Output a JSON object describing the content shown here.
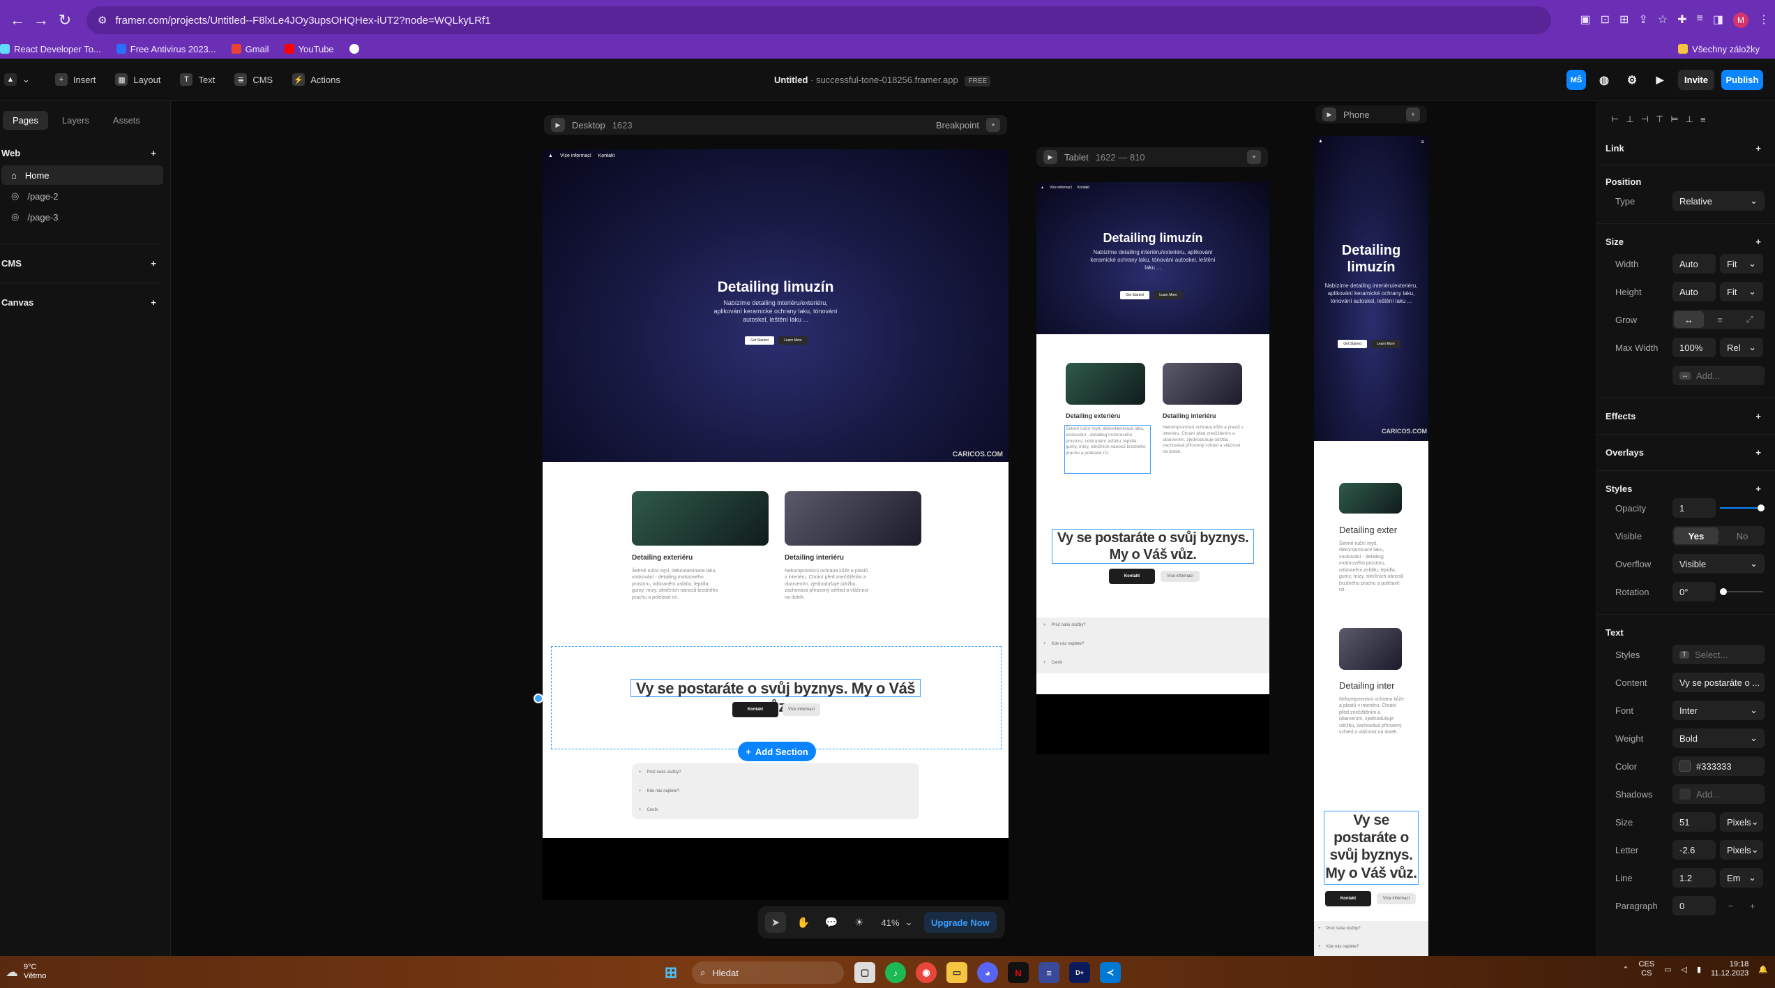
{
  "browser": {
    "url": "framer.com/projects/Untitled--F8lxLe4JOy3upsOHQHex-iUT2?node=WQLkyLRf1",
    "bookmarks": [
      {
        "label": "React Developer To...",
        "color": "#61dafb"
      },
      {
        "label": "Free Antivirus 2023...",
        "color": "#2b6fff"
      },
      {
        "label": "Gmail",
        "color": "#ea4335"
      },
      {
        "label": "YouTube",
        "color": "#ff0000"
      },
      {
        "label": "",
        "color": "#ffffff"
      }
    ],
    "all_bookmarks": "Všechny záložky",
    "profile_initial": "M"
  },
  "toolbar": {
    "insert": "Insert",
    "layout": "Layout",
    "text": "Text",
    "cms": "CMS",
    "actions": "Actions",
    "project_name": "Untitled",
    "project_domain": "· successful-tone-018256.framer.app",
    "free_badge": "FREE",
    "user_badge": "MŠ",
    "invite": "Invite",
    "publish": "Publish",
    "accent": "#0a84ff"
  },
  "left_panel": {
    "tabs": [
      "Pages",
      "Layers",
      "Assets"
    ],
    "web_heading": "Web",
    "pages": [
      "Home",
      "/page-2",
      "/page-3"
    ],
    "cms_heading": "CMS",
    "canvas_heading": "Canvas"
  },
  "frames": {
    "desktop": {
      "name": "Desktop",
      "size": "1623",
      "breakpoint": "Breakpoint"
    },
    "tablet": {
      "name": "Tablet",
      "size": "1622 — 810"
    },
    "phone": {
      "name": "Phone"
    }
  },
  "site": {
    "nav": [
      "Více informací",
      "Kontakt"
    ],
    "hero_title": "Detailing limuzín",
    "hero_text": "Nabízíme detailing interiéru/exteriéru, aplikování keramické ochrany laku, tónování autoskel, leštění laku ...",
    "btn_start": "Get Started",
    "btn_learn": "Learn More",
    "watermark": "CARICOS.COM",
    "card1_title": "Detailing exteriéru",
    "card1_text": "Šetrné ruční mytí, dekontaminace laku, voskování - detailing motorového prostoru, odstranění asfaltu, lepidla, gumy, mízy, silničních nánosů brzdného prachu a polétavé rzi.",
    "card2_title": "Detailing interiéru",
    "card2_text": "Nekompromisní ochrana kůže a plastů v interiéru. Chrání před znečištěním a obarvením, zjednodušuje údržbu, zachovává přirozený vzhled a vláčnost na dotek.",
    "phone_card1_title": "Detailing exter",
    "phone_card2_title": "Detailing inter",
    "cta": "Vy se postaráte o svůj byznys. My o Váš vůz.",
    "cta_tablet_1": "Vy se postaráte o svůj byznys.",
    "cta_tablet_2": "My o Váš vůz.",
    "btn_contact": "Kontakt",
    "btn_more": "Více informací",
    "faq": [
      "Proč naše služby?",
      "Kde nás najdete?",
      "Ceník"
    ],
    "add_section": "Add Section"
  },
  "bottom_bar": {
    "zoom": "41%",
    "upgrade": "Upgrade Now"
  },
  "right_panel": {
    "link": "Link",
    "position": "Position",
    "type_label": "Type",
    "type_value": "Relative",
    "size": "Size",
    "width_label": "Width",
    "width_value": "Auto",
    "width_mode": "Fit",
    "height_label": "Height",
    "height_value": "Auto",
    "height_mode": "Fit",
    "grow_label": "Grow",
    "maxwidth_label": "Max Width",
    "maxwidth_value": "100%",
    "maxwidth_mode": "Rel",
    "add_placeholder": "Add...",
    "effects": "Effects",
    "overlays": "Overlays",
    "styles": "Styles",
    "opacity_label": "Opacity",
    "opacity_value": "1",
    "visible_label": "Visible",
    "visible_yes": "Yes",
    "visible_no": "No",
    "overflow_label": "Overflow",
    "overflow_value": "Visible",
    "rotation_label": "Rotation",
    "rotation_value": "0°",
    "text_heading": "Text",
    "tstyles_label": "Styles",
    "tstyles_value": "Select...",
    "content_label": "Content",
    "content_value": "Vy se postaráte o ...",
    "font_label": "Font",
    "font_value": "Inter",
    "weight_label": "Weight",
    "weight_value": "Bold",
    "color_label": "Color",
    "color_value": "#333333",
    "shadows_label": "Shadows",
    "shadows_value": "Add...",
    "size_label": "Size",
    "size_value": "51",
    "size_unit": "Pixels",
    "letter_label": "Letter",
    "letter_value": "-2.6",
    "letter_unit": "Pixels",
    "line_label": "Line",
    "line_value": "1.2",
    "line_unit": "Em",
    "paragraph_label": "Paragraph",
    "paragraph_value": "0"
  },
  "taskbar": {
    "weather_temp": "9°C",
    "weather_desc": "Větrno",
    "search": "Hledat",
    "lang1": "CES",
    "lang2": "CS",
    "time": "19:18",
    "date": "11.12.2023"
  }
}
